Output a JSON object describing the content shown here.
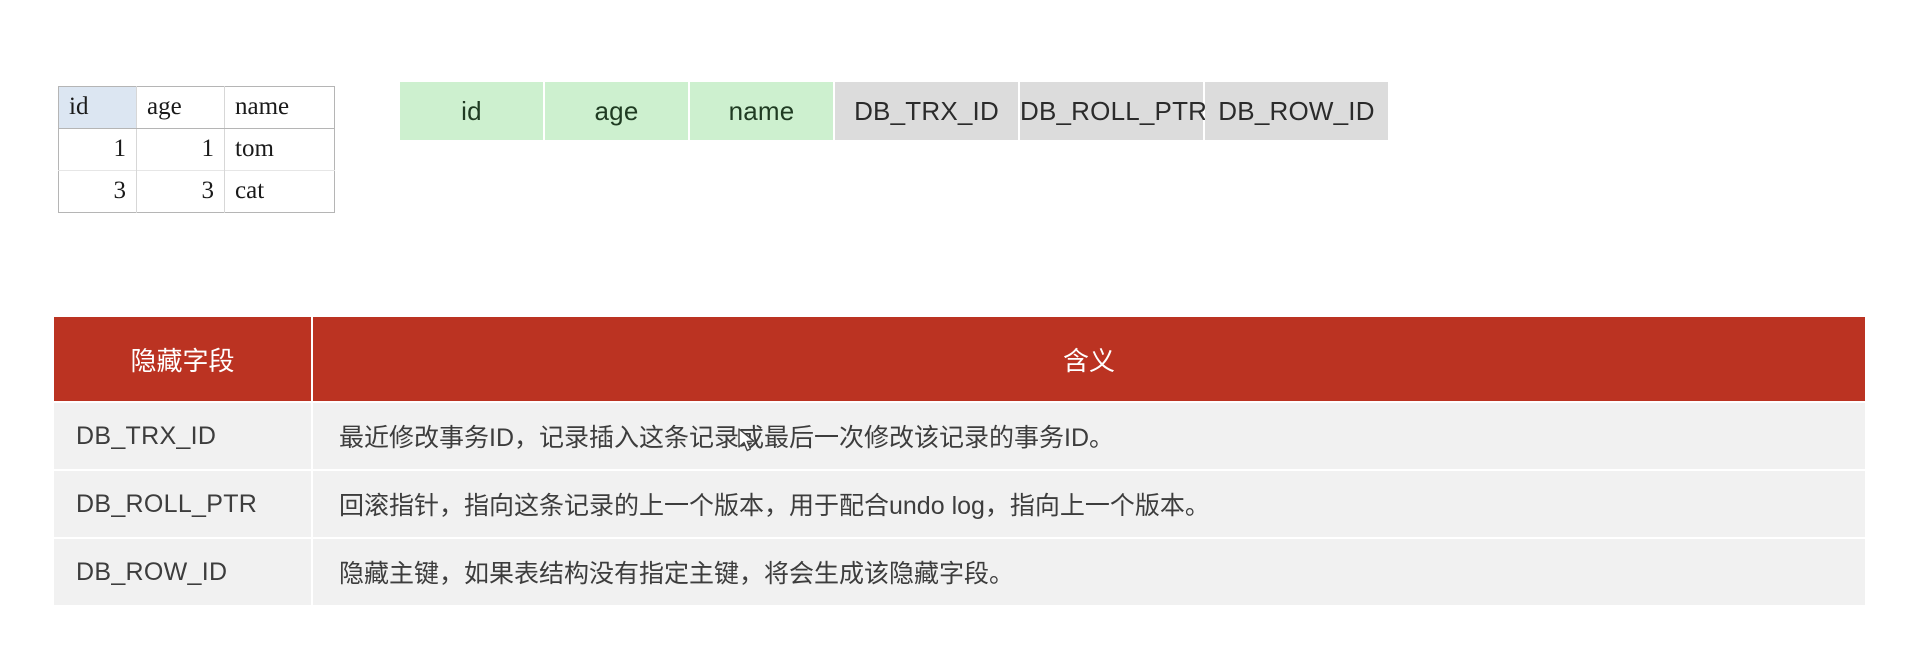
{
  "record_table": {
    "headers": [
      "id",
      "age",
      "name"
    ],
    "rows": [
      [
        "1",
        "1",
        "tom"
      ],
      [
        "3",
        "3",
        "cat"
      ]
    ]
  },
  "column_chips": {
    "visible_columns": [
      "id",
      "age",
      "name"
    ],
    "hidden_columns": [
      "DB_TRX_ID",
      "DB_ROLL_PTR",
      "DB_ROW_ID"
    ],
    "visible_color": "#cdf0cf",
    "hidden_color": "#dcdcdc"
  },
  "meaning_table": {
    "header_color": "#bb3322",
    "headers": [
      "隐藏字段",
      "含义"
    ],
    "rows": [
      {
        "field": "DB_TRX_ID",
        "meaning": "最近修改事务ID，记录插入这条记录或最后一次修改该记录的事务ID。"
      },
      {
        "field": "DB_ROLL_PTR",
        "meaning": "回滚指针，指向这条记录的上一个版本，用于配合undo log，指向上一个版本。"
      },
      {
        "field": "DB_ROW_ID",
        "meaning": "隐藏主键，如果表结构没有指定主键，将会生成该隐藏字段。"
      }
    ]
  }
}
